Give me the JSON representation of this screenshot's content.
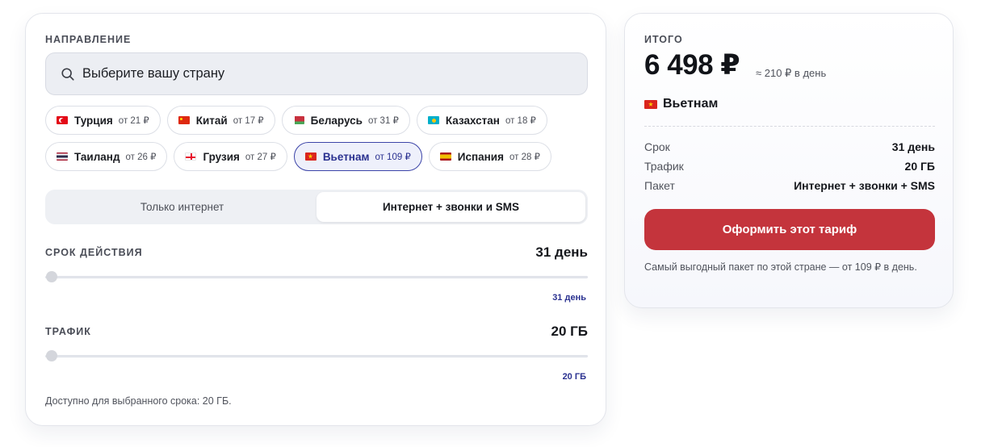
{
  "left": {
    "direction_label": "НАПРАВЛЕНИЕ",
    "search": {
      "placeholder": "Выберите вашу страну"
    },
    "countries": [
      {
        "name": "Турция",
        "price": "от 21 ₽",
        "flag": "flag-turkey"
      },
      {
        "name": "Китай",
        "price": "от 17 ₽",
        "flag": "flag-china"
      },
      {
        "name": "Беларусь",
        "price": "от 31 ₽",
        "flag": "flag-belarus"
      },
      {
        "name": "Казахстан",
        "price": "от 18 ₽",
        "flag": "flag-kazakhstan"
      },
      {
        "name": "Таиланд",
        "price": "от 26 ₽",
        "flag": "flag-thailand"
      },
      {
        "name": "Грузия",
        "price": "от 27 ₽",
        "flag": "flag-georgia"
      },
      {
        "name": "Вьетнам",
        "price": "от 109 ₽",
        "flag": "flag-vietnam",
        "selected": true
      },
      {
        "name": "Испания",
        "price": "от 28 ₽",
        "flag": "flag-spain"
      }
    ],
    "tabs": [
      {
        "label": "Только интернет",
        "active": false
      },
      {
        "label": "Интернет + звонки и SMS",
        "active": true
      }
    ],
    "duration": {
      "label": "СРОК ДЕЙСТВИЯ",
      "value": "31 день",
      "tag": "31 день",
      "slider_fraction": 0
    },
    "traffic": {
      "label": "ТРАФИК",
      "value": "20 ГБ",
      "tag": "20 ГБ",
      "slider_fraction": 0
    },
    "note": "Доступно для выбранного срока: 20 ГБ."
  },
  "summary": {
    "label": "ИТОГО",
    "price": "6 498 ₽",
    "per_day": "≈ 210 ₽ в день",
    "country": "Вьетнам",
    "rows": [
      {
        "key": "Срок",
        "value": "31 день"
      },
      {
        "key": "Трафик",
        "value": "20 ГБ"
      },
      {
        "key": "Пакет",
        "value": "Интернет + звонки + SMS"
      }
    ],
    "cta_label": "Оформить этот тариф",
    "footnote": "Самый выгодный пакет по этой стране — от 109 ₽ в день."
  },
  "colors": {
    "accent": "#c4343c",
    "selected": "#2a3190"
  }
}
